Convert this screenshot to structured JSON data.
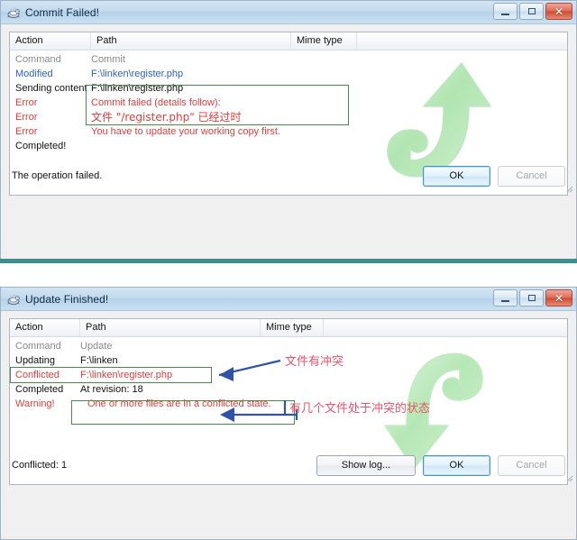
{
  "dialogs": [
    {
      "id": "commit-failed",
      "title": "Commit Failed!",
      "icon": "tortoisesvn-icon",
      "window_buttons": {
        "minimize": "minimize-button",
        "maximize": "maximize-button",
        "close": "close-button"
      },
      "columns": [
        {
          "label": "Action"
        },
        {
          "label": "Path"
        },
        {
          "label": "Mime type"
        },
        {
          "label": ""
        }
      ],
      "rows": [
        {
          "action": "Command",
          "path": "Commit",
          "color": "gray"
        },
        {
          "action": "Modified",
          "path": "F:\\linken\\register.php",
          "color": "blue"
        },
        {
          "action": "Sending content",
          "path": "F:\\linken\\register.php",
          "color": "black"
        },
        {
          "action": "Error",
          "path": "Commit failed (details follow):",
          "color": "red"
        },
        {
          "action": "Error",
          "path": "文件 \"/register.php\" 已经过时",
          "color": "red"
        },
        {
          "action": "Error",
          "path": "You have to update your working copy first.",
          "color": "red"
        },
        {
          "action": "Completed!",
          "path": "",
          "color": "black"
        }
      ],
      "watermark": "commit-arrow-up-icon",
      "status": "The operation failed.",
      "buttons": [
        {
          "label": "OK",
          "state": "default"
        },
        {
          "label": "Cancel",
          "state": "disabled"
        }
      ]
    },
    {
      "id": "update-finished",
      "title": "Update Finished!",
      "icon": "tortoisesvn-icon",
      "window_buttons": {
        "minimize": "minimize-button",
        "maximize": "maximize-button",
        "close": "close-button"
      },
      "columns": [
        {
          "label": "Action"
        },
        {
          "label": "Path"
        },
        {
          "label": "Mime type"
        },
        {
          "label": ""
        }
      ],
      "rows": [
        {
          "action": "Command",
          "path": "Update",
          "color": "gray"
        },
        {
          "action": "Updating",
          "path": "F:\\linken",
          "color": "black"
        },
        {
          "action": "Conflicted",
          "path": "F:\\linken\\register.php",
          "color": "red"
        },
        {
          "action": "Completed",
          "path": "At revision: 18",
          "color": "black"
        },
        {
          "action": "Warning!",
          "path": "One or more files are in a conflicted state.",
          "color": "red"
        }
      ],
      "annotations": [
        {
          "text": "文件有冲突"
        },
        {
          "text": "有几个文件处于冲突的状态"
        }
      ],
      "watermark": "update-arrow-down-icon",
      "status": "Conflicted: 1",
      "buttons": [
        {
          "label": "Show log...",
          "state": "normal"
        },
        {
          "label": "OK",
          "state": "default"
        },
        {
          "label": "Cancel",
          "state": "disabled"
        }
      ]
    }
  ],
  "colors": {
    "annotation_red": "#e8536a",
    "annotation_box_green": "#4a8a4a",
    "annotation_arrow_blue": "#2f53a8",
    "error_red": "#e23b3b",
    "modified_blue": "#2b5fc4",
    "watermark_green": "#9fdc9f",
    "separator_teal": "#3f8d8d"
  }
}
